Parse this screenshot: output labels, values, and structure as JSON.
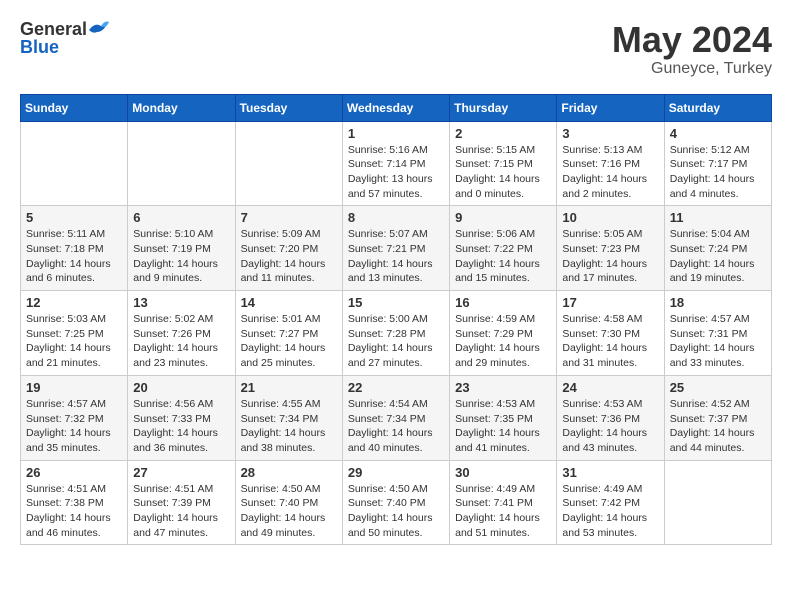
{
  "header": {
    "logo_general": "General",
    "logo_blue": "Blue",
    "month": "May 2024",
    "location": "Guneyce, Turkey"
  },
  "days_of_week": [
    "Sunday",
    "Monday",
    "Tuesday",
    "Wednesday",
    "Thursday",
    "Friday",
    "Saturday"
  ],
  "weeks": [
    [
      {
        "day": "",
        "text": ""
      },
      {
        "day": "",
        "text": ""
      },
      {
        "day": "",
        "text": ""
      },
      {
        "day": "1",
        "text": "Sunrise: 5:16 AM\nSunset: 7:14 PM\nDaylight: 13 hours and 57 minutes."
      },
      {
        "day": "2",
        "text": "Sunrise: 5:15 AM\nSunset: 7:15 PM\nDaylight: 14 hours and 0 minutes."
      },
      {
        "day": "3",
        "text": "Sunrise: 5:13 AM\nSunset: 7:16 PM\nDaylight: 14 hours and 2 minutes."
      },
      {
        "day": "4",
        "text": "Sunrise: 5:12 AM\nSunset: 7:17 PM\nDaylight: 14 hours and 4 minutes."
      }
    ],
    [
      {
        "day": "5",
        "text": "Sunrise: 5:11 AM\nSunset: 7:18 PM\nDaylight: 14 hours and 6 minutes."
      },
      {
        "day": "6",
        "text": "Sunrise: 5:10 AM\nSunset: 7:19 PM\nDaylight: 14 hours and 9 minutes."
      },
      {
        "day": "7",
        "text": "Sunrise: 5:09 AM\nSunset: 7:20 PM\nDaylight: 14 hours and 11 minutes."
      },
      {
        "day": "8",
        "text": "Sunrise: 5:07 AM\nSunset: 7:21 PM\nDaylight: 14 hours and 13 minutes."
      },
      {
        "day": "9",
        "text": "Sunrise: 5:06 AM\nSunset: 7:22 PM\nDaylight: 14 hours and 15 minutes."
      },
      {
        "day": "10",
        "text": "Sunrise: 5:05 AM\nSunset: 7:23 PM\nDaylight: 14 hours and 17 minutes."
      },
      {
        "day": "11",
        "text": "Sunrise: 5:04 AM\nSunset: 7:24 PM\nDaylight: 14 hours and 19 minutes."
      }
    ],
    [
      {
        "day": "12",
        "text": "Sunrise: 5:03 AM\nSunset: 7:25 PM\nDaylight: 14 hours and 21 minutes."
      },
      {
        "day": "13",
        "text": "Sunrise: 5:02 AM\nSunset: 7:26 PM\nDaylight: 14 hours and 23 minutes."
      },
      {
        "day": "14",
        "text": "Sunrise: 5:01 AM\nSunset: 7:27 PM\nDaylight: 14 hours and 25 minutes."
      },
      {
        "day": "15",
        "text": "Sunrise: 5:00 AM\nSunset: 7:28 PM\nDaylight: 14 hours and 27 minutes."
      },
      {
        "day": "16",
        "text": "Sunrise: 4:59 AM\nSunset: 7:29 PM\nDaylight: 14 hours and 29 minutes."
      },
      {
        "day": "17",
        "text": "Sunrise: 4:58 AM\nSunset: 7:30 PM\nDaylight: 14 hours and 31 minutes."
      },
      {
        "day": "18",
        "text": "Sunrise: 4:57 AM\nSunset: 7:31 PM\nDaylight: 14 hours and 33 minutes."
      }
    ],
    [
      {
        "day": "19",
        "text": "Sunrise: 4:57 AM\nSunset: 7:32 PM\nDaylight: 14 hours and 35 minutes."
      },
      {
        "day": "20",
        "text": "Sunrise: 4:56 AM\nSunset: 7:33 PM\nDaylight: 14 hours and 36 minutes."
      },
      {
        "day": "21",
        "text": "Sunrise: 4:55 AM\nSunset: 7:34 PM\nDaylight: 14 hours and 38 minutes."
      },
      {
        "day": "22",
        "text": "Sunrise: 4:54 AM\nSunset: 7:34 PM\nDaylight: 14 hours and 40 minutes."
      },
      {
        "day": "23",
        "text": "Sunrise: 4:53 AM\nSunset: 7:35 PM\nDaylight: 14 hours and 41 minutes."
      },
      {
        "day": "24",
        "text": "Sunrise: 4:53 AM\nSunset: 7:36 PM\nDaylight: 14 hours and 43 minutes."
      },
      {
        "day": "25",
        "text": "Sunrise: 4:52 AM\nSunset: 7:37 PM\nDaylight: 14 hours and 44 minutes."
      }
    ],
    [
      {
        "day": "26",
        "text": "Sunrise: 4:51 AM\nSunset: 7:38 PM\nDaylight: 14 hours and 46 minutes."
      },
      {
        "day": "27",
        "text": "Sunrise: 4:51 AM\nSunset: 7:39 PM\nDaylight: 14 hours and 47 minutes."
      },
      {
        "day": "28",
        "text": "Sunrise: 4:50 AM\nSunset: 7:40 PM\nDaylight: 14 hours and 49 minutes."
      },
      {
        "day": "29",
        "text": "Sunrise: 4:50 AM\nSunset: 7:40 PM\nDaylight: 14 hours and 50 minutes."
      },
      {
        "day": "30",
        "text": "Sunrise: 4:49 AM\nSunset: 7:41 PM\nDaylight: 14 hours and 51 minutes."
      },
      {
        "day": "31",
        "text": "Sunrise: 4:49 AM\nSunset: 7:42 PM\nDaylight: 14 hours and 53 minutes."
      },
      {
        "day": "",
        "text": ""
      }
    ]
  ]
}
